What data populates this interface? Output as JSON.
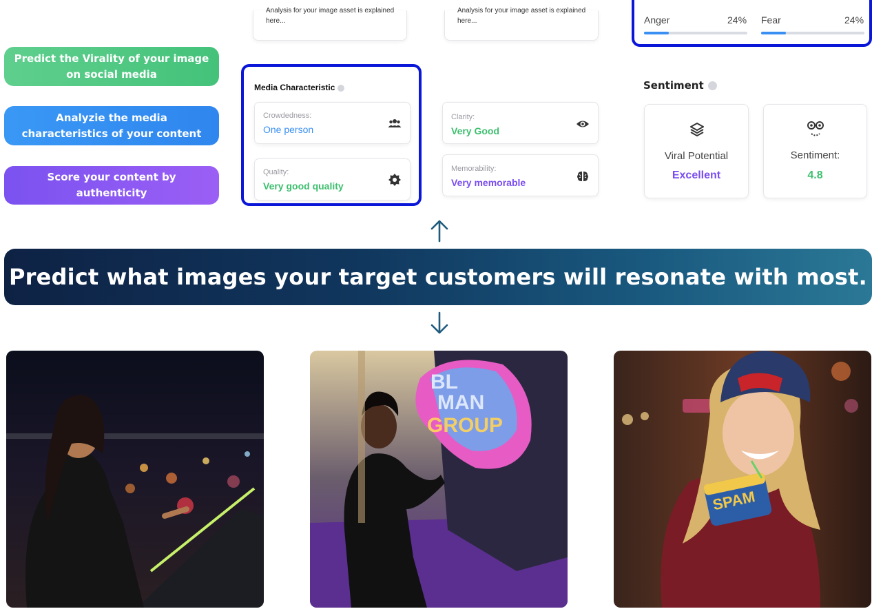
{
  "left_actions": [
    {
      "label": "Predict the Virality of your image on social media"
    },
    {
      "label": "Analyzie the media characteristics of your content"
    },
    {
      "label": "Score your content by authenticity"
    }
  ],
  "explain_cards": [
    {
      "text": "Analysis for your image asset is explained here..."
    },
    {
      "text": "Analysis for your image asset is explained here..."
    }
  ],
  "emotions": [
    {
      "label": "Anger",
      "value": "24%",
      "fraction": 0.24
    },
    {
      "label": "Fear",
      "value": "24%",
      "fraction": 0.24
    }
  ],
  "media": {
    "title": "Media Characteristic",
    "crowdedness": {
      "label": "Crowdedness:",
      "value": "One person",
      "icon": "group-icon"
    },
    "quality": {
      "label": "Quality:",
      "value": "Very good quality",
      "icon": "badge-icon"
    },
    "clarity": {
      "label": "Clarity:",
      "value": "Very Good",
      "icon": "eye-icon"
    },
    "memorability": {
      "label": "Memorability:",
      "value": "Very memorable",
      "icon": "brain-icon"
    }
  },
  "sentiment": {
    "title": "Sentiment",
    "viral": {
      "label": "Viral Potential",
      "value": "Excellent",
      "icon": "layers-icon"
    },
    "score": {
      "label": "Sentiment:",
      "value": "4.8",
      "icon": "face-icon"
    }
  },
  "banner": {
    "text": "Predict what images your target customers will resonate with most."
  },
  "photos": [
    {
      "name": "rooftop-woman-photo"
    },
    {
      "name": "blue-man-group-photo"
    },
    {
      "name": "spam-woman-photo"
    }
  ],
  "colors": {
    "accent_blue": "#0a16d8",
    "value_blue": "#3a8ff3",
    "value_green": "#3dbf6e",
    "value_purple": "#7a4cf0"
  }
}
